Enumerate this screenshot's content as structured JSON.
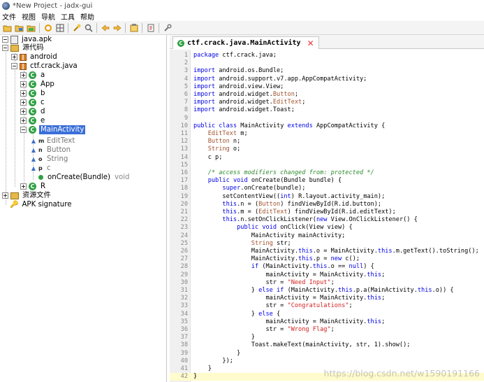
{
  "window": {
    "title": "*New Project - jadx-gui"
  },
  "menu": [
    "文件",
    "视图",
    "导航",
    "工具",
    "帮助"
  ],
  "toolbar_icons": [
    "open-folder-icon",
    "save-icon",
    "save-all-icon",
    "sync-icon",
    "flat-packages-icon",
    "search-icon",
    "find-usage-icon",
    "back-icon",
    "forward-icon",
    "log-icon",
    "deobfuscation-icon",
    "settings-icon"
  ],
  "tree": {
    "root": "java.apk",
    "source_root": "源代码",
    "packages": {
      "android": "android",
      "ctf": "ctf.crack.java"
    },
    "classes": [
      "a",
      "App",
      "b",
      "c",
      "d",
      "e"
    ],
    "selected_class": "MainActivity",
    "members": [
      {
        "modifier": "m",
        "name": "EditText",
        "kind": "field"
      },
      {
        "modifier": "n",
        "name": "Button",
        "kind": "field"
      },
      {
        "modifier": "o",
        "name": "String",
        "kind": "field"
      },
      {
        "modifier": "p",
        "name": "c",
        "kind": "field"
      },
      {
        "modifier": "",
        "name": "onCreate(Bundle)",
        "type": "void",
        "kind": "method"
      }
    ],
    "after_class": "R",
    "resources": "资源文件",
    "signature": "APK signature"
  },
  "editor": {
    "tab_label": "ctf.crack.java.MainActivity",
    "current_line": 42,
    "lines": [
      "package ctf.crack.java;",
      "",
      "import android.os.Bundle;",
      "import android.support.v7.app.AppCompatActivity;",
      "import android.view.View;",
      "import android.widget.Button;",
      "import android.widget.EditText;",
      "import android.widget.Toast;",
      "",
      "public class MainActivity extends AppCompatActivity {",
      "    EditText m;",
      "    Button n;",
      "    String o;",
      "    c p;",
      "",
      "    /* access modifiers changed from: protected */",
      "    public void onCreate(Bundle bundle) {",
      "        super.onCreate(bundle);",
      "        setContentView((int) R.layout.activity_main);",
      "        this.n = (Button) findViewById(R.id.button);",
      "        this.m = (EditText) findViewById(R.id.editText);",
      "        this.n.setOnClickListener(new View.OnClickListener() {",
      "            public void onClick(View view) {",
      "                MainActivity mainActivity;",
      "                String str;",
      "                MainActivity.this.o = MainActivity.this.m.getText().toString();",
      "                MainActivity.this.p = new c();",
      "                if (MainActivity.this.o == null) {",
      "                    mainActivity = MainActivity.this;",
      "                    str = \"Need Input\";",
      "                } else if (MainActivity.this.p.a(MainActivity.this.o)) {",
      "                    mainActivity = MainActivity.this;",
      "                    str = \"Congratulations\";",
      "                } else {",
      "                    mainActivity = MainActivity.this;",
      "                    str = \"Wrong Flag\";",
      "                }",
      "                Toast.makeText(mainActivity, str, 1).show();",
      "            }",
      "        });",
      "    }",
      "}"
    ]
  },
  "watermark": "https://blog.csdn.net/w1590191166"
}
